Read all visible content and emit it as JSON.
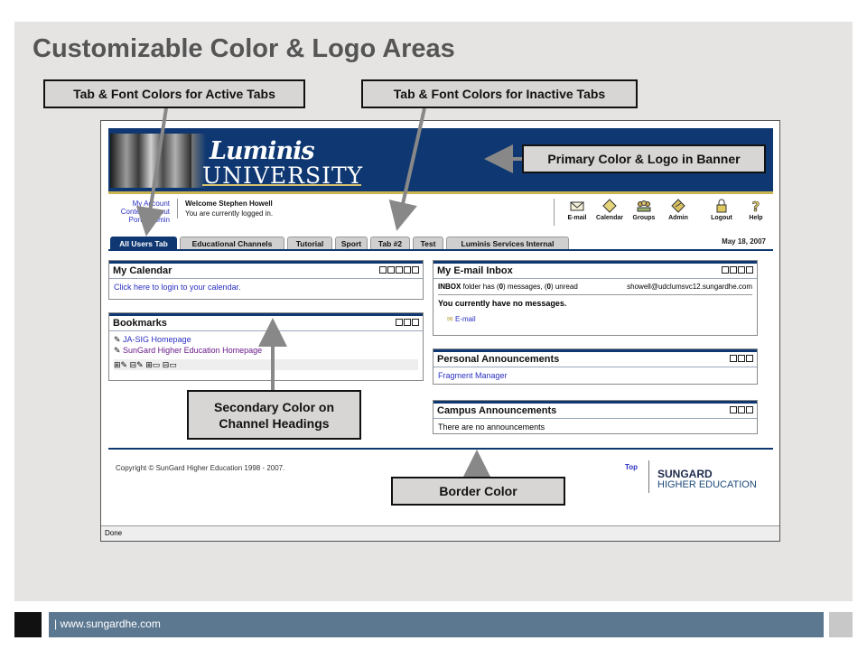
{
  "slide": {
    "title": "Customizable Color & Logo Areas",
    "footer_url": "| www.sungardhe.com"
  },
  "callouts": {
    "active_tabs": "Tab & Font Colors for Active Tabs",
    "inactive_tabs": "Tab & Font Colors for Inactive Tabs",
    "banner": "Primary Color & Logo in Banner",
    "secondary_line1": "Secondary Color on",
    "secondary_line2": "Channel Headings",
    "border": "Border Color"
  },
  "portal": {
    "logo_script": "Luminis",
    "logo_word": "UNIVERSITY",
    "left_links": [
      "My Account",
      "Content Layout",
      "Portal Admin"
    ],
    "welcome": "Welcome Stephen Howell",
    "logged_in": "You are currently logged in.",
    "toolbar": [
      {
        "label": "E-mail",
        "icon": "envelope-icon"
      },
      {
        "label": "Calendar",
        "icon": "calendar-icon"
      },
      {
        "label": "Groups",
        "icon": "groups-icon"
      },
      {
        "label": "Admin",
        "icon": "admin-icon"
      },
      {
        "label": "Logout",
        "icon": "lock-icon"
      },
      {
        "label": "Help",
        "icon": "help-icon"
      }
    ],
    "tabs": [
      "All Users Tab",
      "Educational Channels",
      "Tutorial",
      "Sport",
      "Tab #2",
      "Test",
      "Luminis Services Internal"
    ],
    "date": "May 18, 2007",
    "calendar": {
      "title": "My Calendar",
      "link": "Click here to login to your calendar."
    },
    "bookmarks": {
      "title": "Bookmarks",
      "items": [
        "JA-SIG Homepage",
        "SunGard Higher Education Homepage"
      ]
    },
    "inbox": {
      "title": "My E-mail Inbox",
      "status_bold1": "INBOX",
      "status_mid": " folder has (",
      "count1": "0",
      "status_mid2": ") messages, (",
      "count2": "0",
      "status_end": ") unread",
      "address": "showell@udclumsvc12.sungardhe.com",
      "no_messages": "You currently have no messages.",
      "email_link": "E-mail"
    },
    "personal": {
      "title": "Personal Announcements",
      "link": "Fragment Manager"
    },
    "campus": {
      "title": "Campus Announcements",
      "text": "There are no announcements"
    },
    "copyright": "Copyright © SunGard Higher Education 1998 - 2007.",
    "top_link": "Top",
    "sungard_line1": "SUNGARD",
    "sungard_line2": "HIGHER EDUCATION",
    "status": "Done"
  },
  "colors": {
    "primary": "#0f3872",
    "secondary": "#c8b450",
    "callout_fill": "#d8d6d4",
    "arrow": "#888888"
  }
}
